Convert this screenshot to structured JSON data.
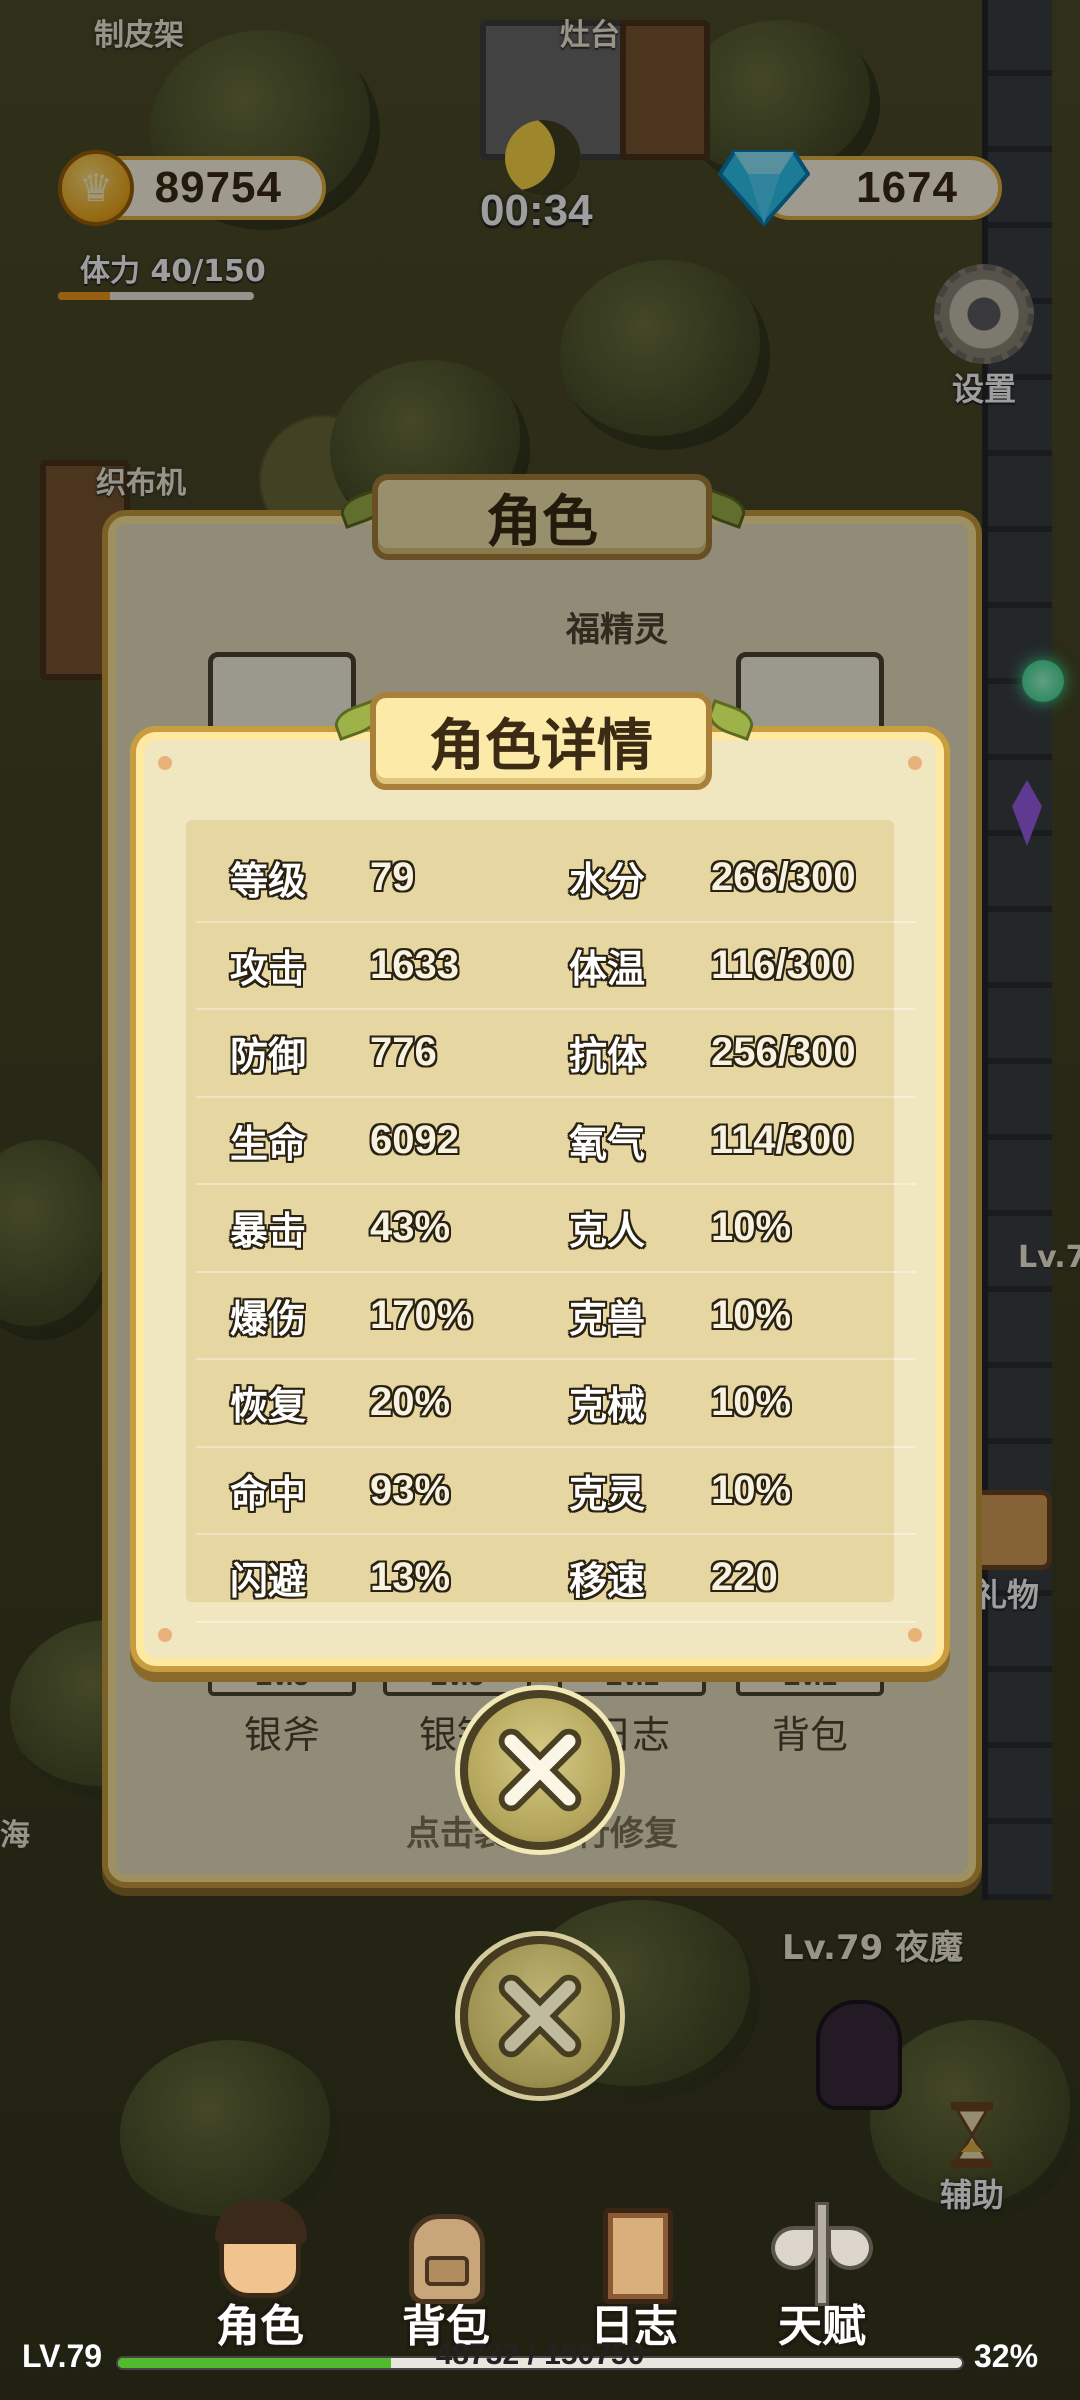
{
  "hud": {
    "coins": "89754",
    "gems": "1674",
    "timer": "00:34",
    "stamina": "体力 40/150",
    "stamina_fraction": 0.267,
    "settings_label": "设置",
    "gift_label": "礼物",
    "assist_label": "辅助"
  },
  "world_labels": {
    "tanning_rack": "制皮架",
    "stove": "灶台",
    "loom": "织布机",
    "sea": "海",
    "side_level": "Lv.7",
    "enemy": "Lv.79 夜魔"
  },
  "character_panel": {
    "title": "角色",
    "pet_name": "福精灵",
    "equipment": [
      {
        "level": "Lv.5",
        "name": "银斧"
      },
      {
        "level": "Lv.5",
        "name": "银镐"
      },
      {
        "level": "Lv.1",
        "name": "日志"
      },
      {
        "level": "Lv.1",
        "name": "背包"
      }
    ],
    "repair_hint": "点击装备进行修复"
  },
  "detail_panel": {
    "title": "角色详情",
    "stats": [
      {
        "l1": "等级",
        "v1": "79",
        "l2": "水分",
        "v2": "266/300"
      },
      {
        "l1": "攻击",
        "v1": "1633",
        "l2": "体温",
        "v2": "116/300"
      },
      {
        "l1": "防御",
        "v1": "776",
        "l2": "抗体",
        "v2": "256/300"
      },
      {
        "l1": "生命",
        "v1": "6092",
        "l2": "氧气",
        "v2": "114/300"
      },
      {
        "l1": "暴击",
        "v1": "43%",
        "l2": "克人",
        "v2": "10%"
      },
      {
        "l1": "爆伤",
        "v1": "170%",
        "l2": "克兽",
        "v2": "10%"
      },
      {
        "l1": "恢复",
        "v1": "20%",
        "l2": "克械",
        "v2": "10%"
      },
      {
        "l1": "命中",
        "v1": "93%",
        "l2": "克灵",
        "v2": "10%"
      },
      {
        "l1": "闪避",
        "v1": "13%",
        "l2": "移速",
        "v2": "220"
      }
    ]
  },
  "bottom_nav": {
    "items": [
      {
        "label": "角色",
        "icon": "character-icon"
      },
      {
        "label": "背包",
        "icon": "backpack-icon"
      },
      {
        "label": "日志",
        "icon": "journal-icon"
      },
      {
        "label": "天赋",
        "icon": "talent-icon"
      }
    ]
  },
  "xp": {
    "level": "LV.79",
    "progress": "48732 / 150750",
    "percent": "32%",
    "fraction": 0.323
  },
  "colors": {
    "gold": "#f0a91c",
    "gem": "#2ec9f0",
    "panel": "#f0e6c0",
    "xp_green": "#4fbb2d",
    "stamina_orange": "#f29a1c"
  }
}
